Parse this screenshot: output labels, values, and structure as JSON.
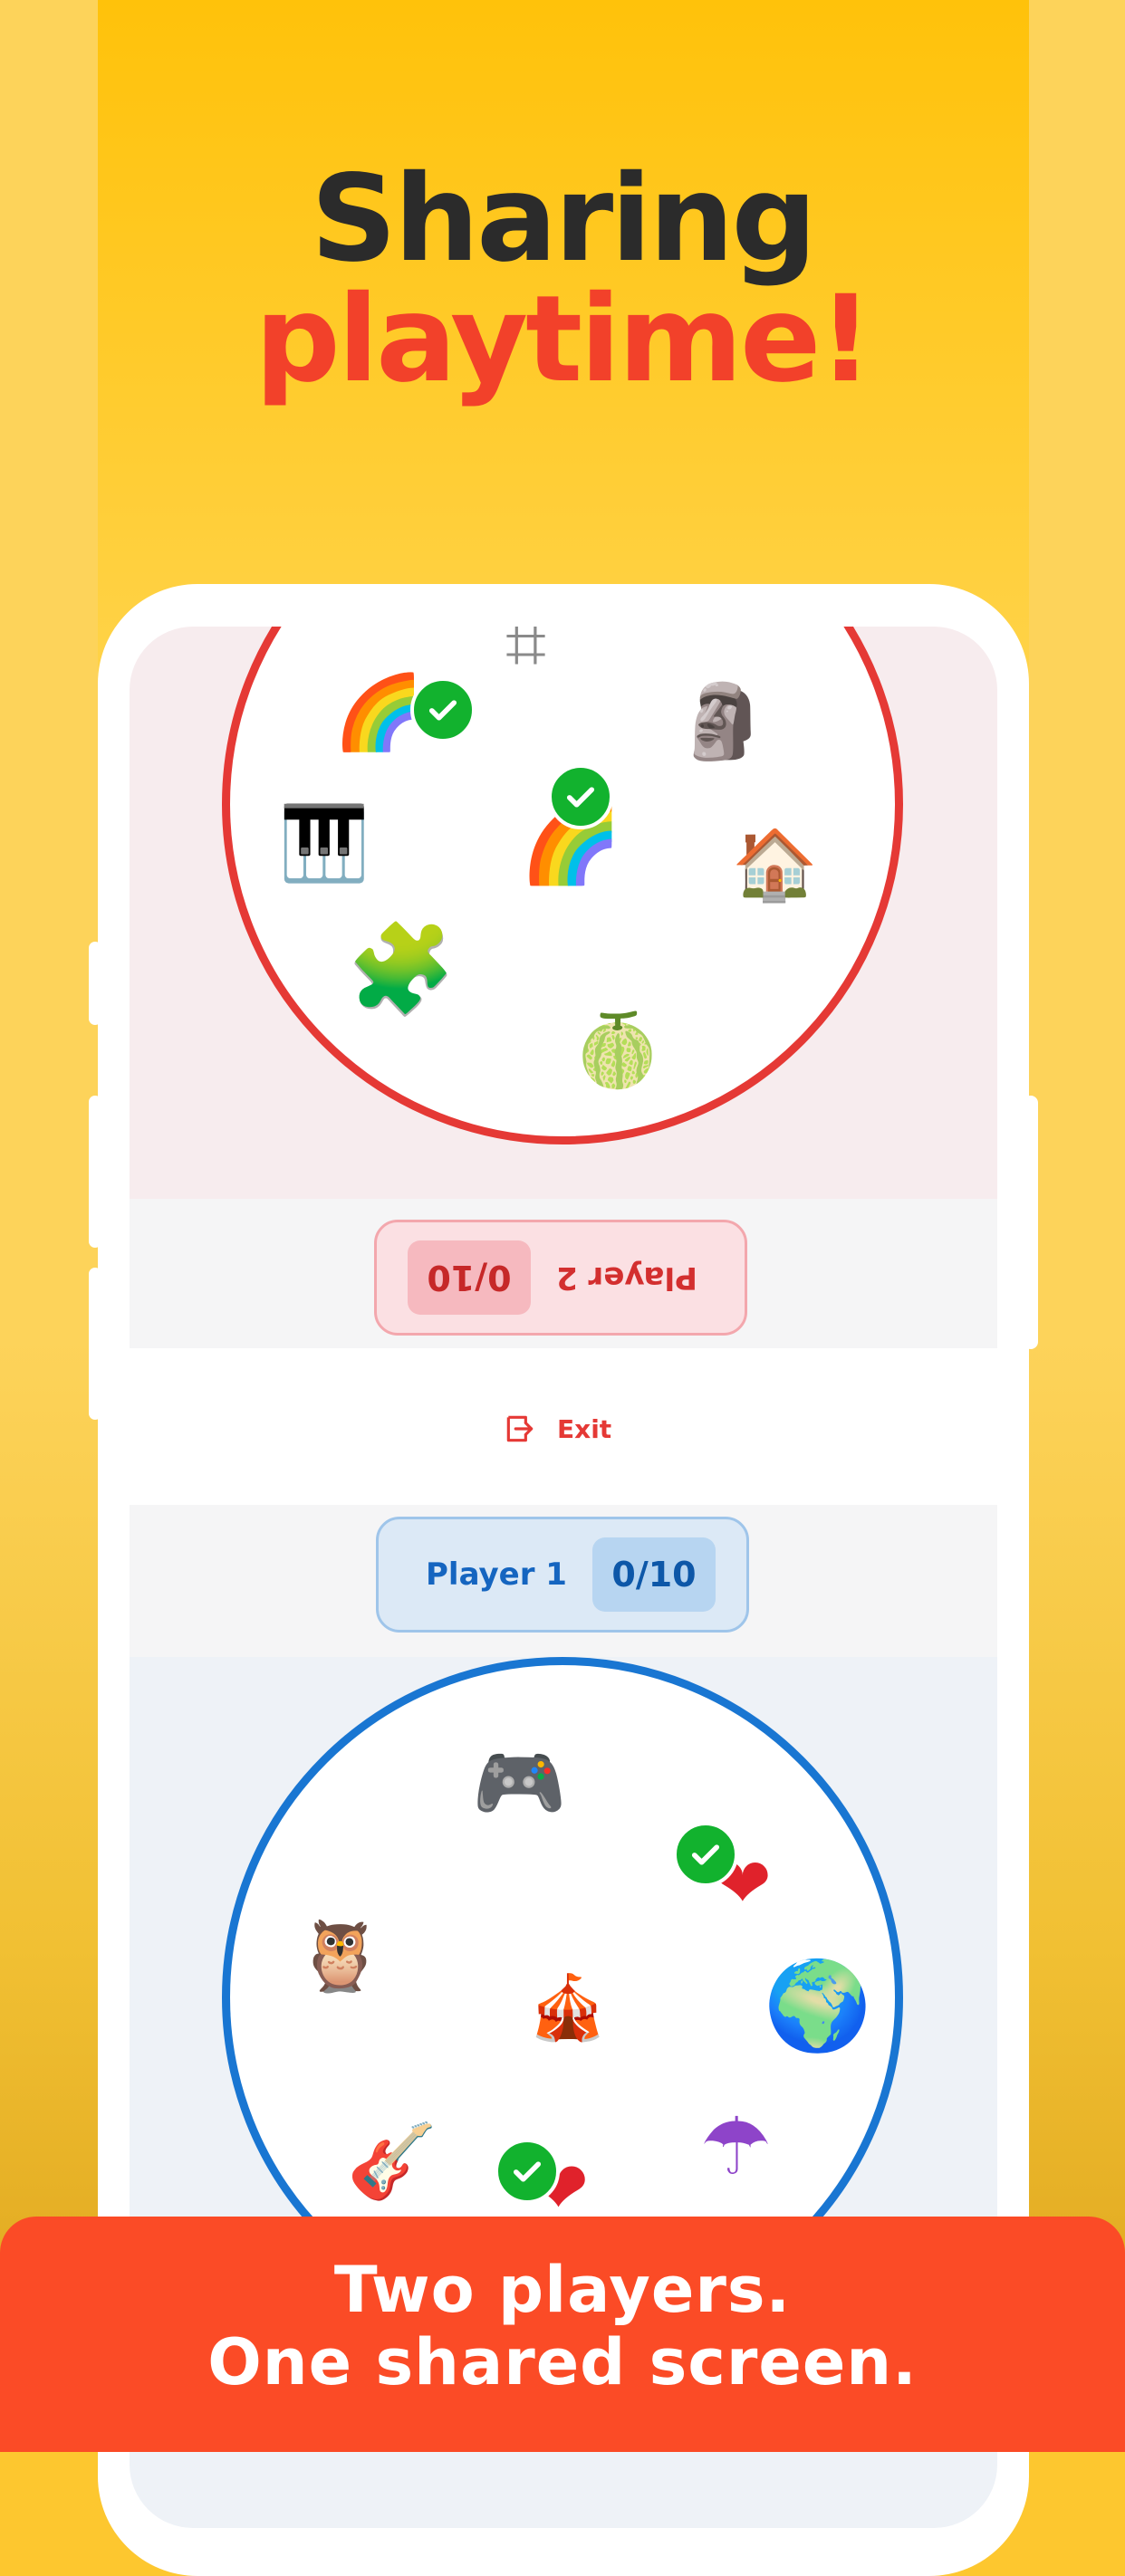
{
  "headline": {
    "line1": "Sharing",
    "line2": "playtime!"
  },
  "game": {
    "player2": {
      "name": "Player 2",
      "score": "0/10"
    },
    "player1": {
      "name": "Player 1",
      "score": "0/10"
    },
    "exit_label": "Exit",
    "top_board_items": [
      {
        "icon": "net-icon",
        "glyph": "⌗",
        "found": false
      },
      {
        "icon": "rainbow-icon",
        "glyph": "🌈",
        "found": true
      },
      {
        "icon": "moai-icon",
        "glyph": "🗿",
        "found": false
      },
      {
        "icon": "piano-icon",
        "glyph": "🎹",
        "found": false
      },
      {
        "icon": "rainbow-icon",
        "glyph": "🌈",
        "found": true
      },
      {
        "icon": "house-icon",
        "glyph": "🏠",
        "found": false
      },
      {
        "icon": "puzzle-icon",
        "glyph": "🧩",
        "found": false
      },
      {
        "icon": "custard-apple-icon",
        "glyph": "🍈",
        "found": false
      }
    ],
    "bottom_board_items": [
      {
        "icon": "game-controller-icon",
        "glyph": "🎮",
        "found": false
      },
      {
        "icon": "heart-icon",
        "glyph": "❤",
        "found": true
      },
      {
        "icon": "owl-icon",
        "glyph": "🦉",
        "found": false
      },
      {
        "icon": "circus-tent-icon",
        "glyph": "🎪",
        "found": false
      },
      {
        "icon": "globe-icon",
        "glyph": "🌍",
        "found": false
      },
      {
        "icon": "guitar-icon",
        "glyph": "🎸",
        "found": false
      },
      {
        "icon": "heart-icon",
        "glyph": "❤",
        "found": true
      },
      {
        "icon": "umbrella-icon",
        "glyph": "☂",
        "found": false
      }
    ]
  },
  "banner": {
    "line1": "Two players.",
    "line2": "One shared screen."
  },
  "colors": {
    "background": "#ffc20a",
    "headline_dark": "#2b2b2b",
    "headline_accent": "#f2412a",
    "player2": "#e53935",
    "player1": "#1976d2",
    "check": "#12b22e",
    "banner": "#fb4b26"
  }
}
